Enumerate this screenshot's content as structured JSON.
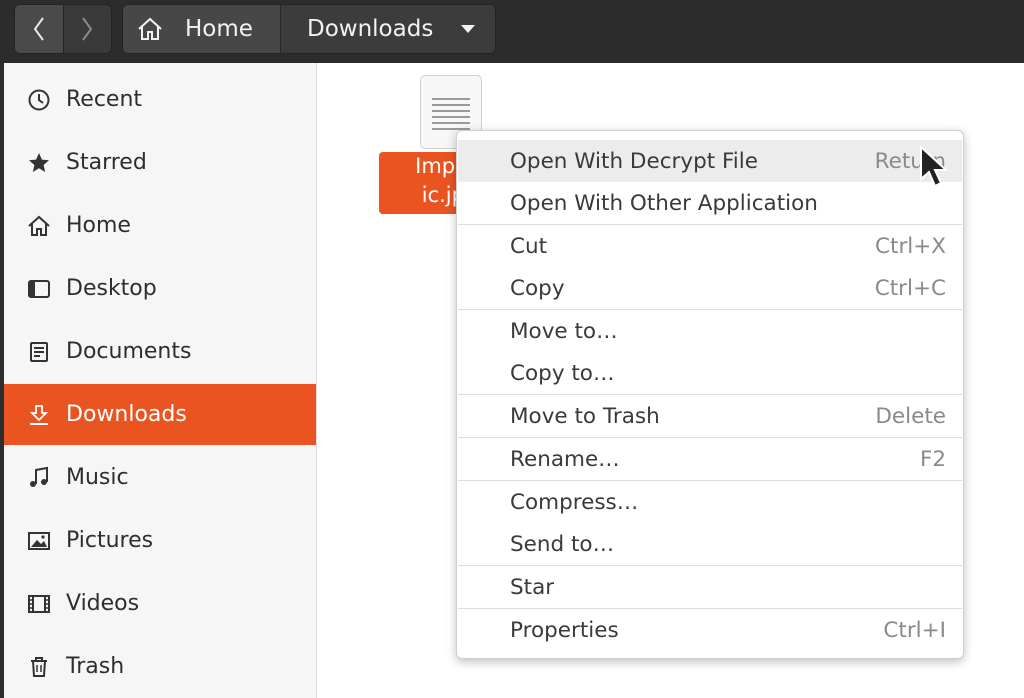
{
  "header": {
    "breadcrumb": [
      "Home",
      "Downloads"
    ]
  },
  "sidebar": {
    "items": [
      {
        "label": "Recent",
        "icon": "clock-icon"
      },
      {
        "label": "Starred",
        "icon": "star-icon"
      },
      {
        "label": "Home",
        "icon": "home-icon"
      },
      {
        "label": "Desktop",
        "icon": "desktop-icon"
      },
      {
        "label": "Documents",
        "icon": "document-icon"
      },
      {
        "label": "Downloads",
        "icon": "download-icon",
        "active": true
      },
      {
        "label": "Music",
        "icon": "music-icon"
      },
      {
        "label": "Pictures",
        "icon": "picture-icon"
      },
      {
        "label": "Videos",
        "icon": "video-icon"
      },
      {
        "label": "Trash",
        "icon": "trash-icon"
      }
    ]
  },
  "file": {
    "label_line1": "Import",
    "label_line2": "ic.jpg"
  },
  "context_menu": {
    "items": [
      {
        "label": "Open With Decrypt File",
        "accel": "Return"
      },
      {
        "label": "Open With Other Application",
        "accel": ""
      },
      {
        "label": "Cut",
        "accel": "Ctrl+X"
      },
      {
        "label": "Copy",
        "accel": "Ctrl+C"
      },
      {
        "label": "Move to…",
        "accel": ""
      },
      {
        "label": "Copy to…",
        "accel": ""
      },
      {
        "label": "Move to Trash",
        "accel": "Delete"
      },
      {
        "label": "Rename…",
        "accel": "F2"
      },
      {
        "label": "Compress…",
        "accel": ""
      },
      {
        "label": "Send to…",
        "accel": ""
      },
      {
        "label": "Star",
        "accel": ""
      },
      {
        "label": "Properties",
        "accel": "Ctrl+I"
      }
    ]
  },
  "colors": {
    "accent": "#e95420",
    "header": "#2c2c2c",
    "sidebar": "#f6f6f6"
  }
}
